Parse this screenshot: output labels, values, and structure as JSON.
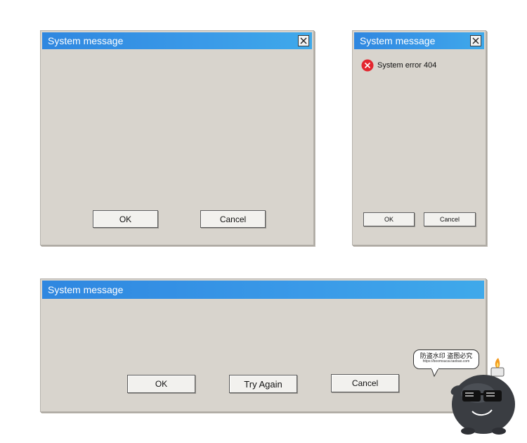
{
  "dialogs": {
    "top_left": {
      "title": "System message",
      "buttons": {
        "ok": "OK",
        "cancel": "Cancel"
      }
    },
    "top_right": {
      "title": "System message",
      "message": "System error 404",
      "buttons": {
        "ok": "OK",
        "cancel": "Cancel"
      }
    },
    "bottom": {
      "title": "System message",
      "buttons": {
        "ok": "OK",
        "try_again": "Try Again",
        "cancel": "Cancel"
      }
    }
  },
  "watermark": {
    "line1": "防盗水印 盗图必究",
    "line2": "https://boomsucai.taobao.com"
  },
  "icons": {
    "close": "close-icon",
    "error": "error-icon",
    "mascot": "bomb-mascot-icon"
  },
  "colors": {
    "titlebar_start": "#2f87e0",
    "titlebar_end": "#3fa9ea",
    "dialog_bg": "#d8d4cd",
    "error_red": "#e3262e"
  }
}
